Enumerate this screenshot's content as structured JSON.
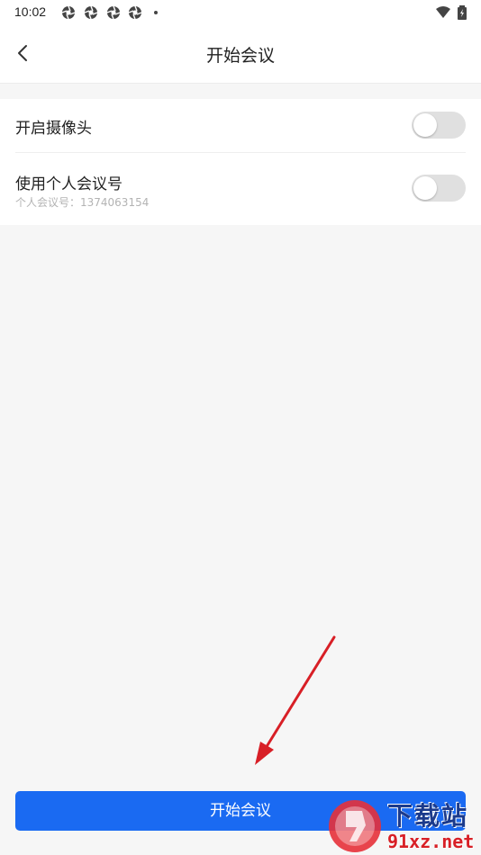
{
  "status_bar": {
    "time": "10:02",
    "notification_icons": [
      "aperture-icon",
      "aperture-icon",
      "aperture-icon",
      "aperture-icon"
    ],
    "system_icons": [
      "wifi-icon",
      "battery-icon"
    ]
  },
  "header": {
    "title": "开始会议",
    "back_icon": "chevron-left-icon"
  },
  "settings": {
    "camera": {
      "label": "开启摄像头",
      "enabled": false
    },
    "personal_meeting_id": {
      "label": "使用个人会议号",
      "sublabel": "个人会议号：1374063154",
      "enabled": false
    }
  },
  "start_button": {
    "label": "开始会议"
  },
  "watermark": {
    "title": "下载站",
    "url": "91xz.net"
  },
  "colors": {
    "accent": "#1a6af2",
    "toggle_off": "#e0e0e0",
    "background": "#f6f6f6",
    "annotation_arrow": "#d81f26"
  }
}
